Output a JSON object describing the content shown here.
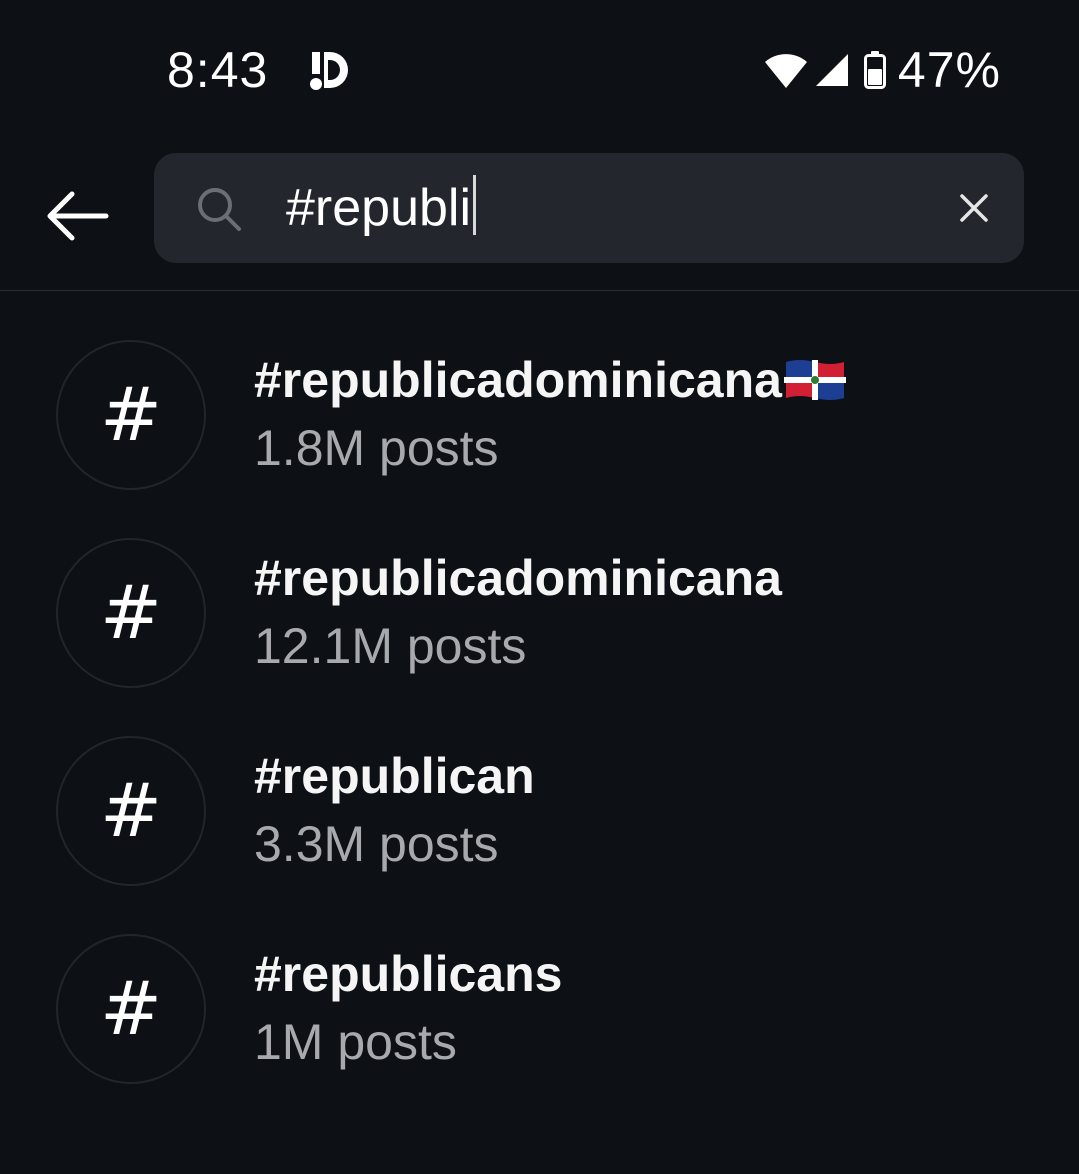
{
  "status_bar": {
    "time": "8:43",
    "battery_percent": "47%",
    "icons": [
      "app-notification-icon",
      "wifi-icon",
      "signal-icon",
      "battery-icon"
    ]
  },
  "search": {
    "query": "#republi",
    "icons": {
      "back": "back-arrow-icon",
      "search": "search-icon",
      "clear": "close-icon"
    }
  },
  "results": [
    {
      "tag": "#republicadominicana",
      "posts": "1.8M posts",
      "has_flag": true,
      "flag": "dominican-republic-flag-icon"
    },
    {
      "tag": "#republicadominicana",
      "posts": "12.1M posts",
      "has_flag": false
    },
    {
      "tag": "#republican",
      "posts": "3.3M posts",
      "has_flag": false
    },
    {
      "tag": "#republicans",
      "posts": "1M posts",
      "has_flag": false
    }
  ],
  "result_icon": {
    "glyph": "#",
    "name": "hashtag-icon"
  },
  "colors": {
    "background": "#0d1116",
    "search_field": "#23272d",
    "primary_text": "#f5f5f5",
    "secondary_text": "#a7a9ad"
  }
}
